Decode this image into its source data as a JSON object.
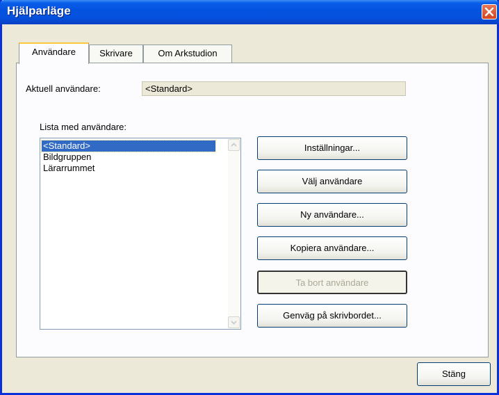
{
  "window": {
    "title": "Hjälparläge"
  },
  "tabs": [
    {
      "label": "Användare",
      "active": true
    },
    {
      "label": "Skrivare",
      "active": false
    },
    {
      "label": "Om Arkstudion",
      "active": false
    }
  ],
  "current_user": {
    "label": "Aktuell användare:",
    "value": "<Standard>"
  },
  "user_list": {
    "label": "Lista med användare:",
    "items": [
      "<Standard>",
      "Bildgruppen",
      "Lärarrummet"
    ],
    "selected": "<Standard>"
  },
  "buttons": {
    "settings": "Inställningar...",
    "select_user": "Välj användare",
    "new_user": "Ny användare...",
    "copy_user": "Kopiera användare...",
    "delete_user": "Ta bort användare",
    "desktop_shortcut": "Genväg på skrivbordet..."
  },
  "footer": {
    "close_label": "Stäng"
  },
  "colors": {
    "titlebar": "#0453E0",
    "selection": "#316AC5",
    "close_red": "#D2461E"
  }
}
